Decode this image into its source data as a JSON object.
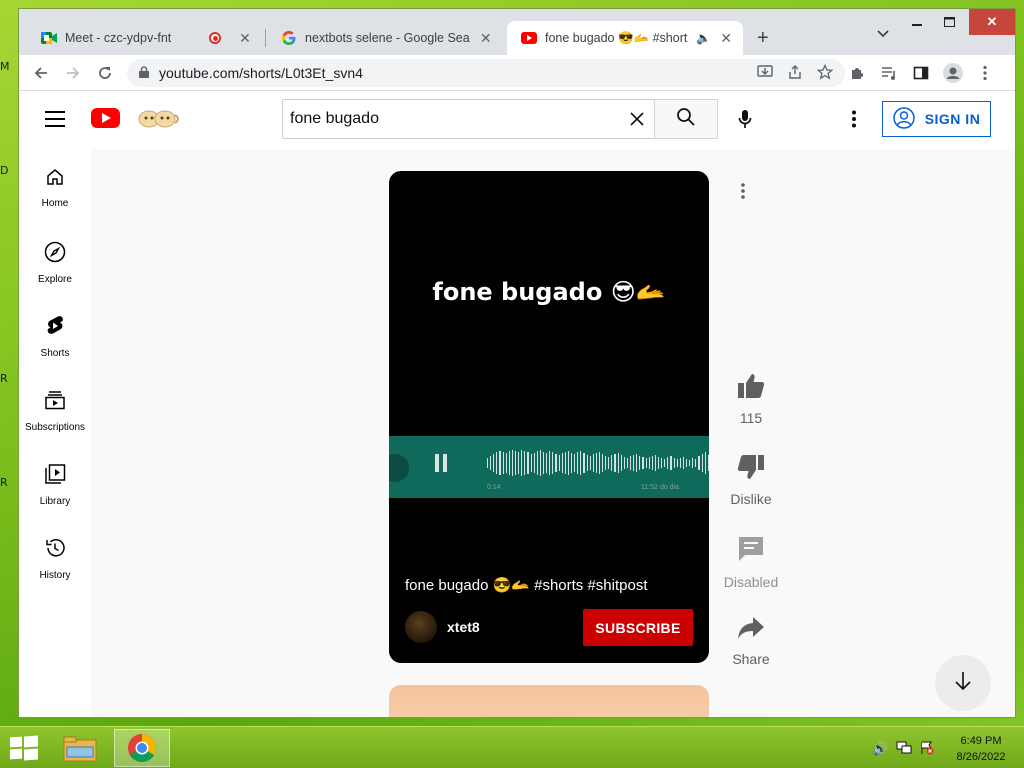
{
  "browser": {
    "tabs": [
      {
        "title": "Meet - czc-ydpv-fnt",
        "favicon": "google-meet-icon",
        "indicator": "recording-dot-icon"
      },
      {
        "title": "nextbots selene - Google Search",
        "favicon": "google-icon"
      },
      {
        "title": "fone bugado 😎🫴 #shorts #s",
        "favicon": "youtube-icon",
        "indicator": "speaker-icon",
        "active": true
      }
    ],
    "url": "youtube.com/shorts/L0t3Et_svn4"
  },
  "youtube": {
    "search_query": "fone bugado",
    "sign_in_label": "SIGN IN",
    "guide": [
      {
        "label": "Home",
        "icon": "home-icon"
      },
      {
        "label": "Explore",
        "icon": "compass-icon"
      },
      {
        "label": "Shorts",
        "icon": "shorts-icon"
      },
      {
        "label": "Subscriptions",
        "icon": "subscriptions-icon"
      },
      {
        "label": "Library",
        "icon": "library-icon"
      },
      {
        "label": "History",
        "icon": "history-icon"
      }
    ],
    "short": {
      "overlay_text": "fone bugado 😎🫴",
      "title": "fone bugado 😎🫴 #shorts #shitpost",
      "channel": "xtet8",
      "subscribe_label": "SUBSCRIBE",
      "waveform_left_time": "0:14",
      "waveform_right_time": "11:52 do dia"
    },
    "actions": {
      "like_count": "115",
      "dislike_label": "Dislike",
      "comments_label": "Disabled",
      "share_label": "Share"
    }
  },
  "taskbar": {
    "time": "6:49 PM",
    "date": "8/26/2022"
  },
  "desktop_glyphs": [
    "M",
    "D",
    "R",
    "R"
  ],
  "colors": {
    "accent": "#065fd4",
    "youtube_red": "#ff0000",
    "subscribe_red": "#cc0000"
  }
}
